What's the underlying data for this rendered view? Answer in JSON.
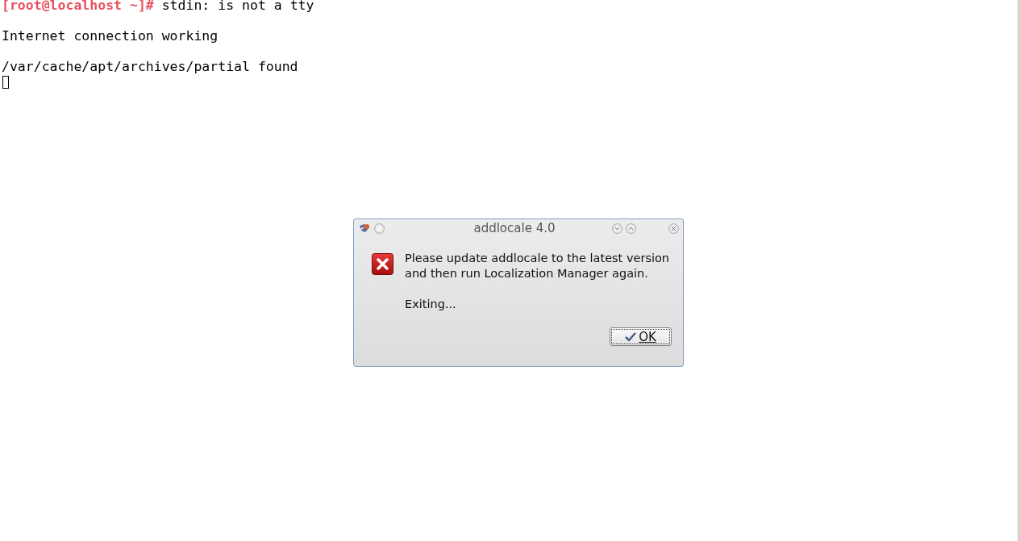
{
  "terminal": {
    "lines": [
      {
        "prompt": "[root@localhost ~]#",
        "text": "stdin: is not a tty"
      },
      {
        "text": "Internet connection working"
      },
      {
        "text": "/var/cache/apt/archives/partial found"
      }
    ],
    "cursor": true
  },
  "dialog": {
    "title": "addlocale 4.0",
    "message": [
      "Please update addlocale to the latest version",
      "and then run Localization Manager again."
    ],
    "detail": "Exiting...",
    "buttons": [
      {
        "label": "OK",
        "focused": true
      }
    ]
  }
}
